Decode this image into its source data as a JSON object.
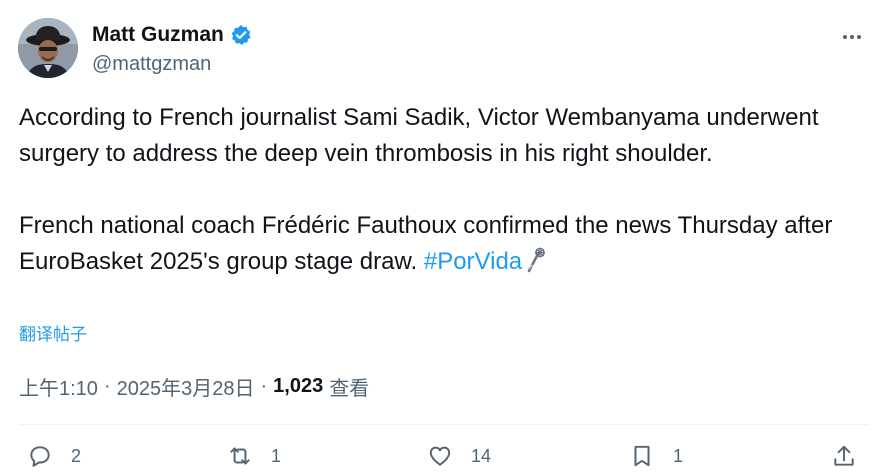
{
  "author": {
    "display_name": "Matt Guzman",
    "handle": "@mattgzman",
    "verified": true
  },
  "tweet": {
    "paragraph_1": "According to French journalist Sami Sadik, Victor Wembanyama underwent surgery to address the deep vein thrombosis in his right shoulder.",
    "paragraph_2": "French national coach Frédéric Fauthoux confirmed the news Thursday after EuroBasket 2025's group stage draw.",
    "hashtag": "#PorVida",
    "emoji_icon": "spurs-emoji-icon"
  },
  "translate_label": "翻译帖子",
  "meta": {
    "time": "上午1:10",
    "separator": "·",
    "date": "2025年3月28日",
    "views_count": "1,023",
    "views_label": "查看"
  },
  "actions": {
    "reply_count": "2",
    "repost_count": "1",
    "like_count": "14",
    "bookmark_count": "1"
  },
  "colors": {
    "accent": "#1d9bf0",
    "text_primary": "#0f1419",
    "text_secondary": "#536471",
    "divider": "#eff3f4"
  }
}
